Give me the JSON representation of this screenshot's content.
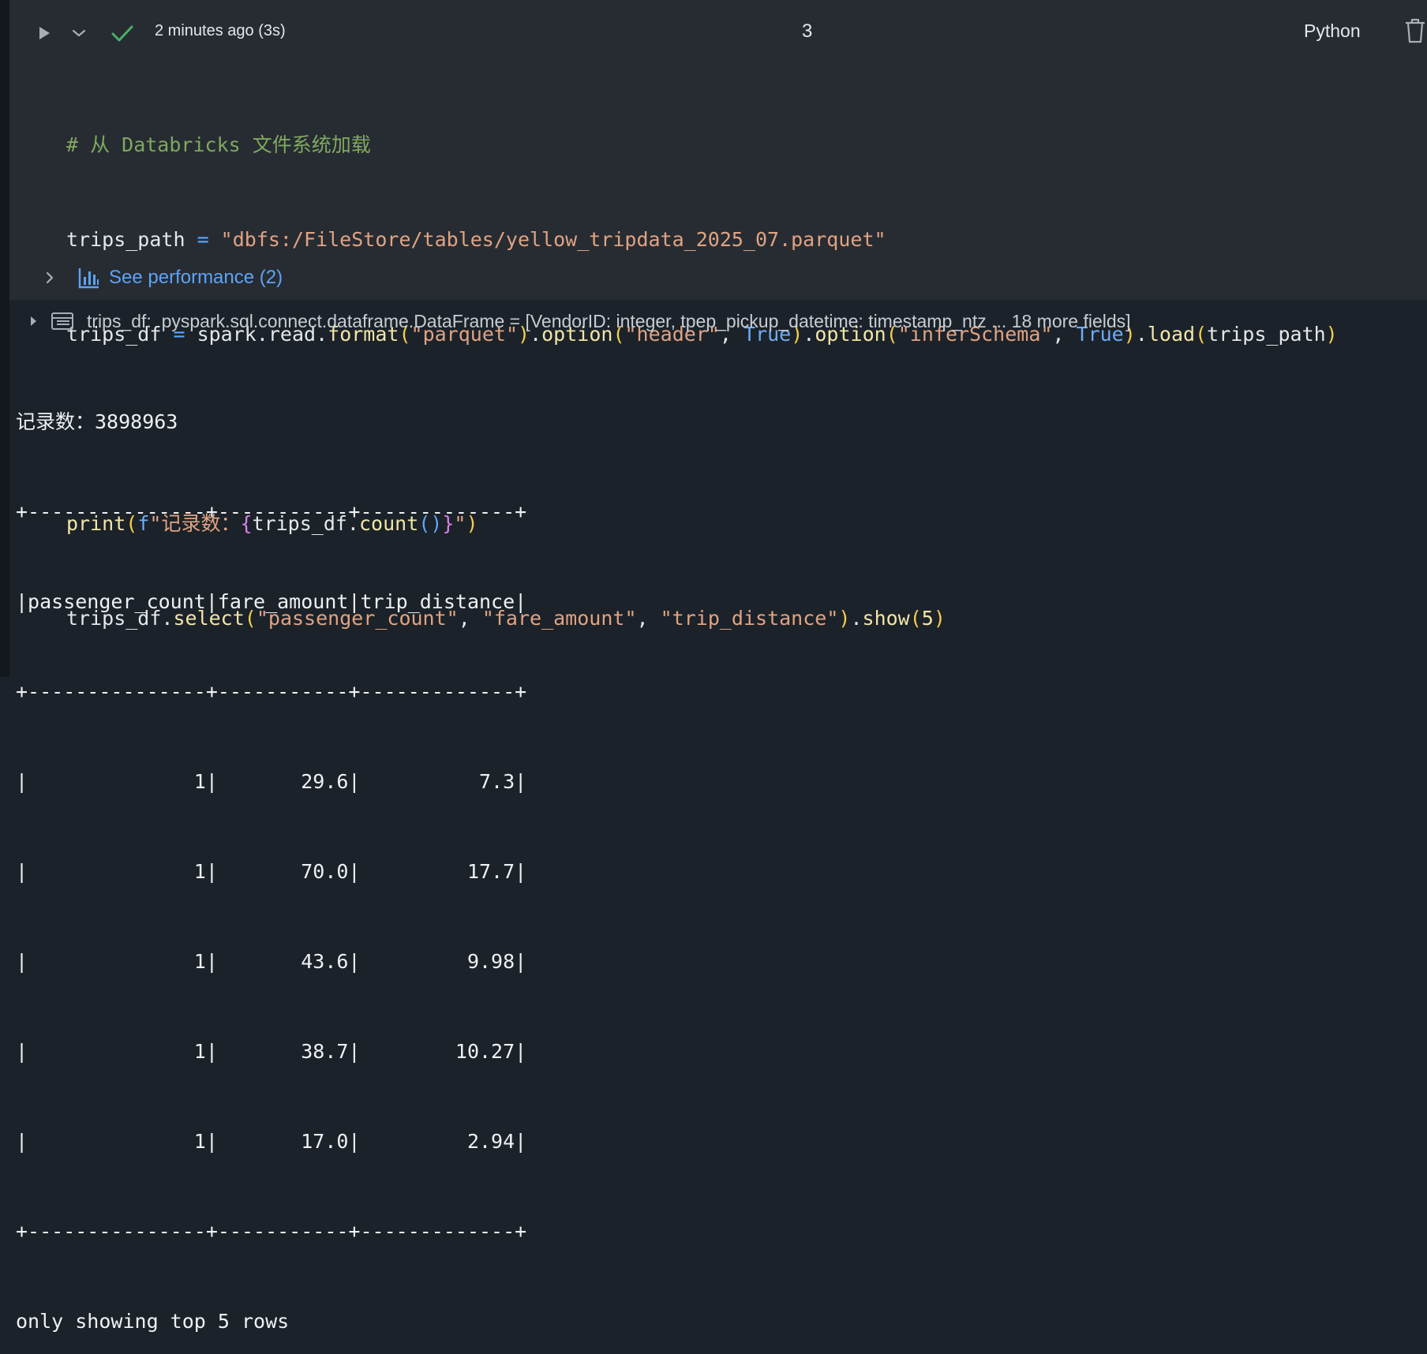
{
  "toolbar": {
    "status": "2 minutes ago (3s)",
    "cell_number": "3",
    "language": "Python"
  },
  "icons": {
    "run": "play-icon",
    "expand": "chevron-down-icon",
    "status": "check-icon",
    "delete": "trash-icon",
    "performance": "bar-chart-icon",
    "dataframe": "table-icon"
  },
  "colors": {
    "cell_bg": "#272c33",
    "output_bg": "#1c2229",
    "success": "#4caf68",
    "link": "#5da3f5",
    "comment": "#7fa860",
    "string": "#e0a382",
    "function": "#f1e6a7",
    "keyword": "#6caef5"
  },
  "code": {
    "line1": {
      "comment": "# 从 Databricks 文件系统加载"
    },
    "line2": {
      "var": "trips_path",
      "eq": " = ",
      "str": "\"dbfs:/FileStore/tables/yellow_tripdata_2025_07.parquet\""
    },
    "line3": {
      "var": "trips_df",
      "eq": " = ",
      "obj": "spark.read.",
      "fn1": "format",
      "arg1": "\"parquet\"",
      "fn2": "option",
      "arg2a": "\"header\"",
      "sep": ", ",
      "kw2": "True",
      "fn3": "option",
      "arg3a": "\"inferSchema\"",
      "kw3": "True",
      "fn4": "load",
      "arg4": "trips_path"
    },
    "line5": {
      "fn": "print",
      "prefix": "f",
      "str_start": "\"记录数：",
      "expr": "trips_df.",
      "call": "count",
      "str_end": "\""
    },
    "line6": {
      "obj": "trips_df.",
      "fn1": "select",
      "a1": "\"passenger_count\"",
      "a2": "\"fare_amount\"",
      "a3": "\"trip_distance\"",
      "fn2": "show",
      "n": "5"
    }
  },
  "performance": {
    "label": "See performance (2)"
  },
  "dataframe_info": {
    "text": "trips_df:  pyspark.sql.connect.dataframe.DataFrame = [VendorID: integer, tpep_pickup_datetime: timestamp_ntz ... 18 more fields]"
  },
  "output": {
    "count_line": "记录数：3898963",
    "border": "+---------------+-----------+-------------+",
    "header": "|passenger_count|fare_amount|trip_distance|",
    "rows": [
      "|              1|       29.6|          7.3|",
      "|              1|       70.0|         17.7|",
      "|              1|       43.6|         9.98|",
      "|              1|       38.7|        10.27|",
      "|              1|       17.0|         2.94|"
    ],
    "footer": "only showing top 5 rows"
  }
}
